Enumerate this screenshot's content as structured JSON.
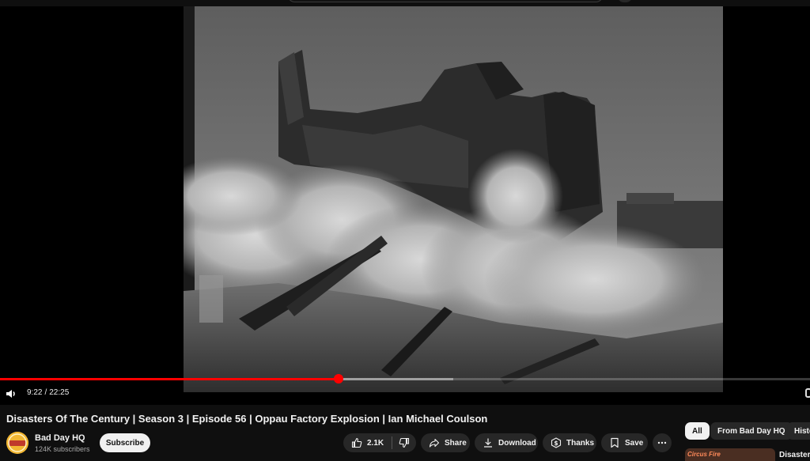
{
  "player": {
    "current_time": "9:22",
    "time_separator": "/",
    "duration": "22:25",
    "progress_fraction": 0.418,
    "buffered_fraction": 0.56
  },
  "video": {
    "title": "Disasters Of The Century | Season 3 | Episode 56 | Oppau Factory Explosion | Ian Michael Coulson"
  },
  "channel": {
    "name": "Bad Day HQ",
    "subscribers": "124K subscribers",
    "subscribe_label": "Subscribe"
  },
  "actions": {
    "like_count": "2.1K",
    "share_label": "Share",
    "download_label": "Download",
    "thanks_label": "Thanks",
    "save_label": "Save"
  },
  "chips": {
    "all": "All",
    "from_channel": "From Bad Day HQ",
    "history": "History"
  },
  "recommendation": {
    "thumb_text": "Circus Fire",
    "title": "Disasters"
  },
  "icons": {
    "volume": "volume-icon",
    "like": "thumbs-up-icon",
    "dislike": "thumbs-down-icon",
    "share": "share-arrow-icon",
    "download": "download-icon",
    "thanks": "thanks-dollar-icon",
    "save": "save-bookmark-icon",
    "more": "more-horizontal-icon"
  },
  "colors": {
    "progress": "#ff0000",
    "background": "#0f0f0f",
    "pill": "#272727"
  }
}
